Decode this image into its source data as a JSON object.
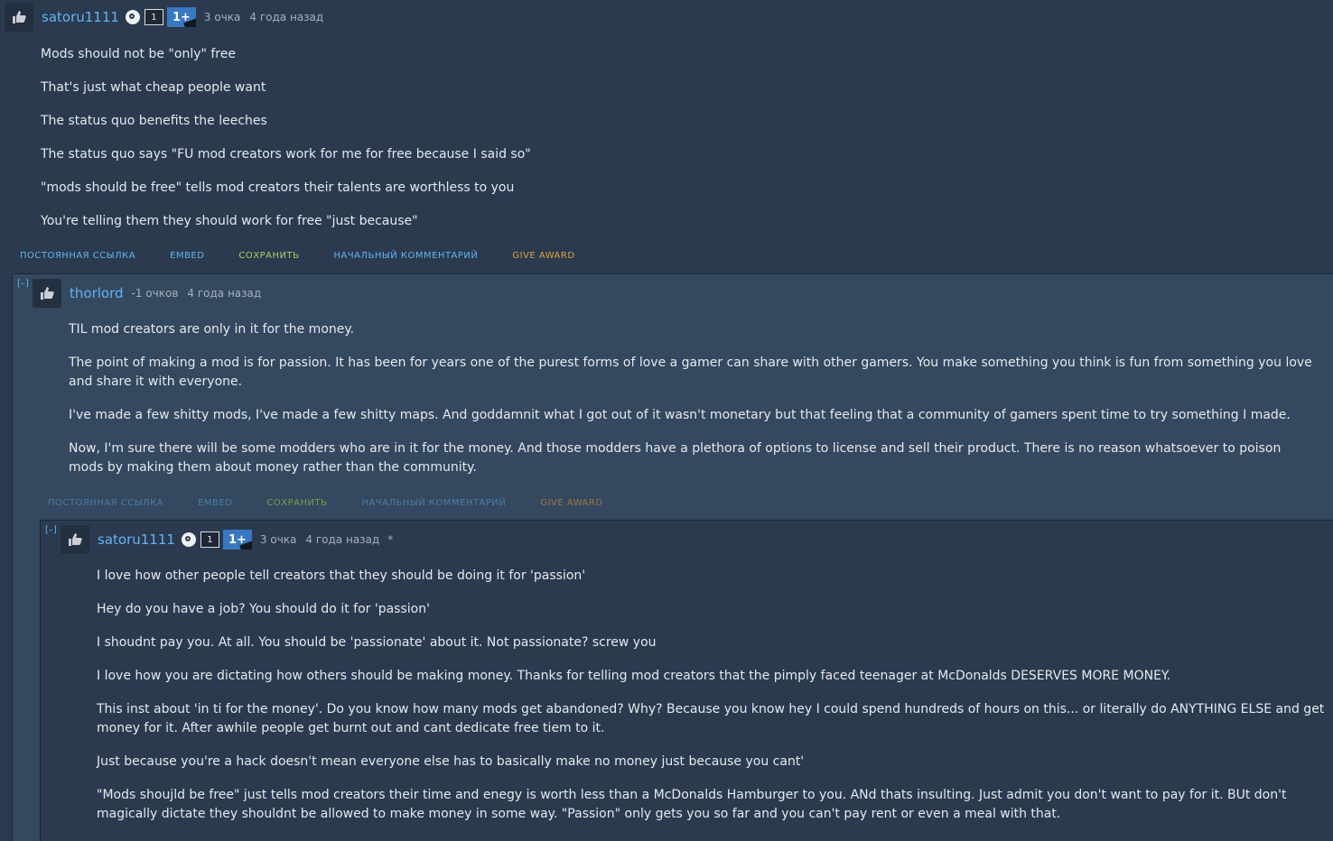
{
  "comment1": {
    "username": "satoru1111",
    "badge_level": "1",
    "badge_plus": "1+",
    "points": "3 очка",
    "time": "4 года назад",
    "paragraphs": [
      "Mods should not be \"only\" free",
      "That's just what cheap people want",
      "The status quo benefits the leeches",
      "The status quo says \"FU mod creators work for me for free because I said so\"",
      "\"mods should be free\" tells mod creators their talents are worthless to you",
      "You're telling them they should work for free \"just because\""
    ],
    "actions": {
      "permalink": "ПОСТОЯННАЯ ССЫЛКА",
      "embed": "EMBED",
      "save": "СОХРАНИТЬ",
      "parent": "НАЧАЛЬНЫЙ КОММЕНТАРИЙ",
      "award": "GIVE AWARD"
    }
  },
  "comment2": {
    "collapse": "[–]",
    "username": "thorlord",
    "points": "-1 очков",
    "time": "4 года назад",
    "paragraphs": [
      "TIL mod creators are only in it for the money.",
      "The point of making a mod is for passion. It has been for years one of the purest forms of love a gamer can share with other gamers. You make something you think is fun from something you love and share it with everyone.",
      "I've made a few shitty mods, I've made a few shitty maps. And goddamnit what I got out of it wasn't monetary but that feeling that a community of gamers spent time to try something I made.",
      "Now, I'm sure there will be some modders who are in it for the money. And those modders have a plethora of options to license and sell their product. There is no reason whatsoever to poison mods by making them about money rather than the community."
    ],
    "actions": {
      "permalink": "ПОСТОЯННАЯ ССЫЛКА",
      "embed": "EMBED",
      "save": "СОХРАНИТЬ",
      "parent": "НАЧАЛЬНЫЙ КОММЕНТАРИЙ",
      "award": "GIVE AWARD"
    }
  },
  "comment3": {
    "collapse": "[–]",
    "username": "satoru1111",
    "badge_level": "1",
    "badge_plus": "1+",
    "points": "3 очка",
    "time": "4 года назад",
    "edited": "*",
    "paragraphs": [
      "I love how other people tell creators that they should be doing it for 'passion'",
      "Hey do you have a job? You should do it for 'passion'",
      "I shoudnt pay you. At all. You should be 'passionate' about it. Not passionate? screw you",
      "I love how you are dictating how others should be making money. Thanks for telling mod creators that the pimply faced teenager at McDonalds DESERVES MORE MONEY.",
      "This inst about 'in ti for the money'. Do you know how many mods get abandoned? Why? Because you know hey I could spend hundreds of hours on this... or literally do ANYTHING ELSE and get money for it. After awhile people get burnt out and cant dedicate free tiem to it.",
      "Just because you're a hack doesn't mean everyone else has to basically make no money just because you cant'",
      "\"Mods shoujld be free\" just tells mod creators their time and enegy is worth less than a McDonalds Hamburger to you. ANd thats insulting. Just admit you don't want to pay for it. BUt don't magically dictate they shouldnt be allowed to make money in some way. \"Passion\" only gets you so far and you can't pay rent or even a meal with that."
    ]
  }
}
